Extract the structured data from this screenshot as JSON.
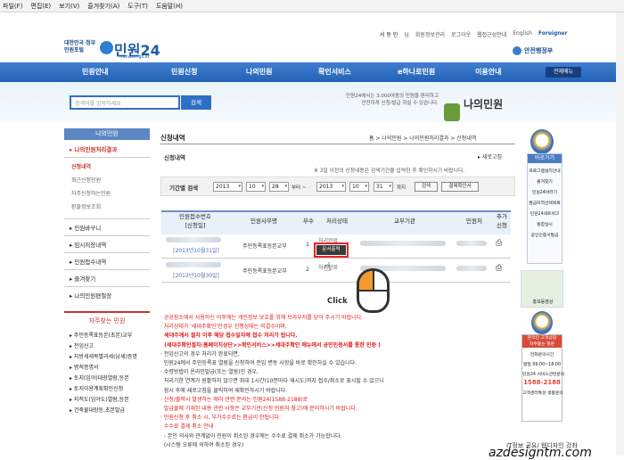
{
  "menubar": [
    "파일(F)",
    "편집(E)",
    "보기(V)",
    "즐겨찾기(A)",
    "도구(T)",
    "도움말(H)"
  ],
  "topbar": {
    "user": "서 동 민",
    "user_suffix": "님",
    "links": [
      "회원정보관리",
      "로그아웃",
      "웹접근성안내",
      "English",
      "Foreigner"
    ]
  },
  "logo": {
    "gov": "대한민국 정부민원포털",
    "name": "민원24",
    "url": "minwon.go.kr"
  },
  "ministry": "안전행정부",
  "gnb": [
    "민원안내",
    "민원신청",
    "나의민원",
    "확인서비스",
    "e하나로민원",
    "이용안내"
  ],
  "allmenu": "전체메뉴",
  "search": {
    "placeholder": "검색어를 입력하세요",
    "button": "검색"
  },
  "hero": {
    "text": "민원24에서는 3,000여종의 민원을 편리하고 안전하게 신청/발급 하실 수 있습니다.",
    "title": "나의민원"
  },
  "lnb": {
    "head": "나의민원",
    "selected": "나의민원처리결과",
    "sub": [
      "신청내역",
      "최근신청민원",
      "자주신청하는민원",
      "환불정보조회"
    ],
    "menus": [
      "민원바구니",
      "임시저장내역",
      "민원접수내역",
      "즐겨찾기",
      "나의민원편철장"
    ]
  },
  "favorites": {
    "title": "자주찾는 민원",
    "items": [
      "주민등록표등본(초본)교부",
      "전입신고",
      "지방세세목별과세(납세)증명",
      "병적증명서",
      "토지(임야)대장열람,등본",
      "토지이용계획확인신청",
      "지적도(임야도)열람,등본",
      "건축물대장등,초본발급"
    ]
  },
  "breadcrumb": "홈 > 나의민원 > 나의민원처리결과 > 신청내역",
  "page_title": "신청내역",
  "subtitle": "신청내역",
  "refresh": "새로고침",
  "note": "※ 3일 이전의 신청내용은 검색기간을 입력한 후 확인하시기 바랍니다.",
  "filter": {
    "label": "기간별 검색",
    "y1": "2013",
    "m1": "10",
    "d1": "28",
    "from": "부터 ~",
    "y2": "2013",
    "m2": "10",
    "d2": "31",
    "to": "까지",
    "search": "검색",
    "clear": "결제확인서"
  },
  "table": {
    "headers": [
      "민원접수번호\n[신청일]",
      "민원사무명",
      "부수",
      "처리상태",
      "교부기관",
      "민원처",
      "추가\n신청"
    ],
    "rows": [
      {
        "date": "[2013년10월31일]",
        "name": "주민등록표등본교부",
        "count": "1",
        "status": "처리완료",
        "doc_btn": "문서출력"
      },
      {
        "date": "[2013년10월30일]",
        "name": "주민등록표등본교부",
        "count": "2",
        "status": "처리완료"
      }
    ]
  },
  "click_label": "Click",
  "notes": [
    {
      "c": "r",
      "t": "· 공공장소에서 사용하신 이후에는 개인정보 보호를 위해 브라우저를 닫아 주시기 바랍니다."
    },
    {
      "c": "r",
      "t": "· 처리상태가 '세대주확인'인경우 진행상태는 미결수이며,"
    },
    {
      "c": "b",
      "t": "  세대주께서 절차 이후 해당 접수일자에 접수 처리가 됩니다."
    },
    {
      "c": "b",
      "t": "  (세대주확인절차:홈페이지상단>>확인서비스>>세대주확인 메뉴에서 공인인증서를 통한 인증 )"
    },
    {
      "c": "g",
      "t": "· 전입신고의 경우 처리가 완료되면,"
    },
    {
      "c": "g",
      "t": "  민원24에서 주민등록표 열람을 신청하여 전입 변동 사항을 바로 확인하실 수 있습니다."
    },
    {
      "c": "g",
      "t": "· 수령방법이 온라인발급(또는 열람)인 경우,"
    },
    {
      "c": "g",
      "t": "  처리기한 연계가 원활하지 않으면 최대 1시간(10분마다 재시도)까지 접수/취소로 표시될 수 있으니"
    },
    {
      "c": "g",
      "t": "  잠시 후에 새로고침을 클릭하여 재확인하시기 바랍니다."
    },
    {
      "c": "r",
      "t": "· 신청/출력시 발생하는 에러 관련 문의는 민원24(1588-2188)로"
    },
    {
      "c": "r",
      "t": "  발급물에 기재된 내용 관련 사항은 교부기관(신청 민원처 참고)에 문의하시기 바랍니다."
    },
    {
      "c": "r",
      "t": "· 민원신청 후 취소 시, 부가수수료는 환급이 안됩니다."
    },
    {
      "c": "r",
      "t": "· 수수료 결제 취소 안내"
    },
    {
      "c": "g",
      "t": "  - 본인 의사와 관계없이 민원이 취소된 경우에는 수수료 결제 취소가 가능합니다."
    },
    {
      "c": "g",
      "t": "  (시스템 오류에 의하여 취소된 경우)"
    }
  ],
  "quick": {
    "title": "바로가기",
    "items": [
      "프로그램설치안내",
      "즐겨찾기",
      "민원24바라기",
      "발급지역선택목록",
      "민원24네트워크",
      "통합실시",
      "공인인증서발급"
    ]
  },
  "promo": "홍보동영상",
  "call": {
    "bar": "온라인 고객상담\n자주묻는 질문",
    "t1": "전화문의시간",
    "t2": "평일 09:00~18:00",
    "t3": "민원24 서비스관련문의",
    "big": "1588-2188",
    "t4": "고객센터특성 생활문의"
  },
  "watermark": {
    "w1": "IT정보 공유/ 웹디자인 강좌",
    "w2": "azdesigntm.com"
  }
}
